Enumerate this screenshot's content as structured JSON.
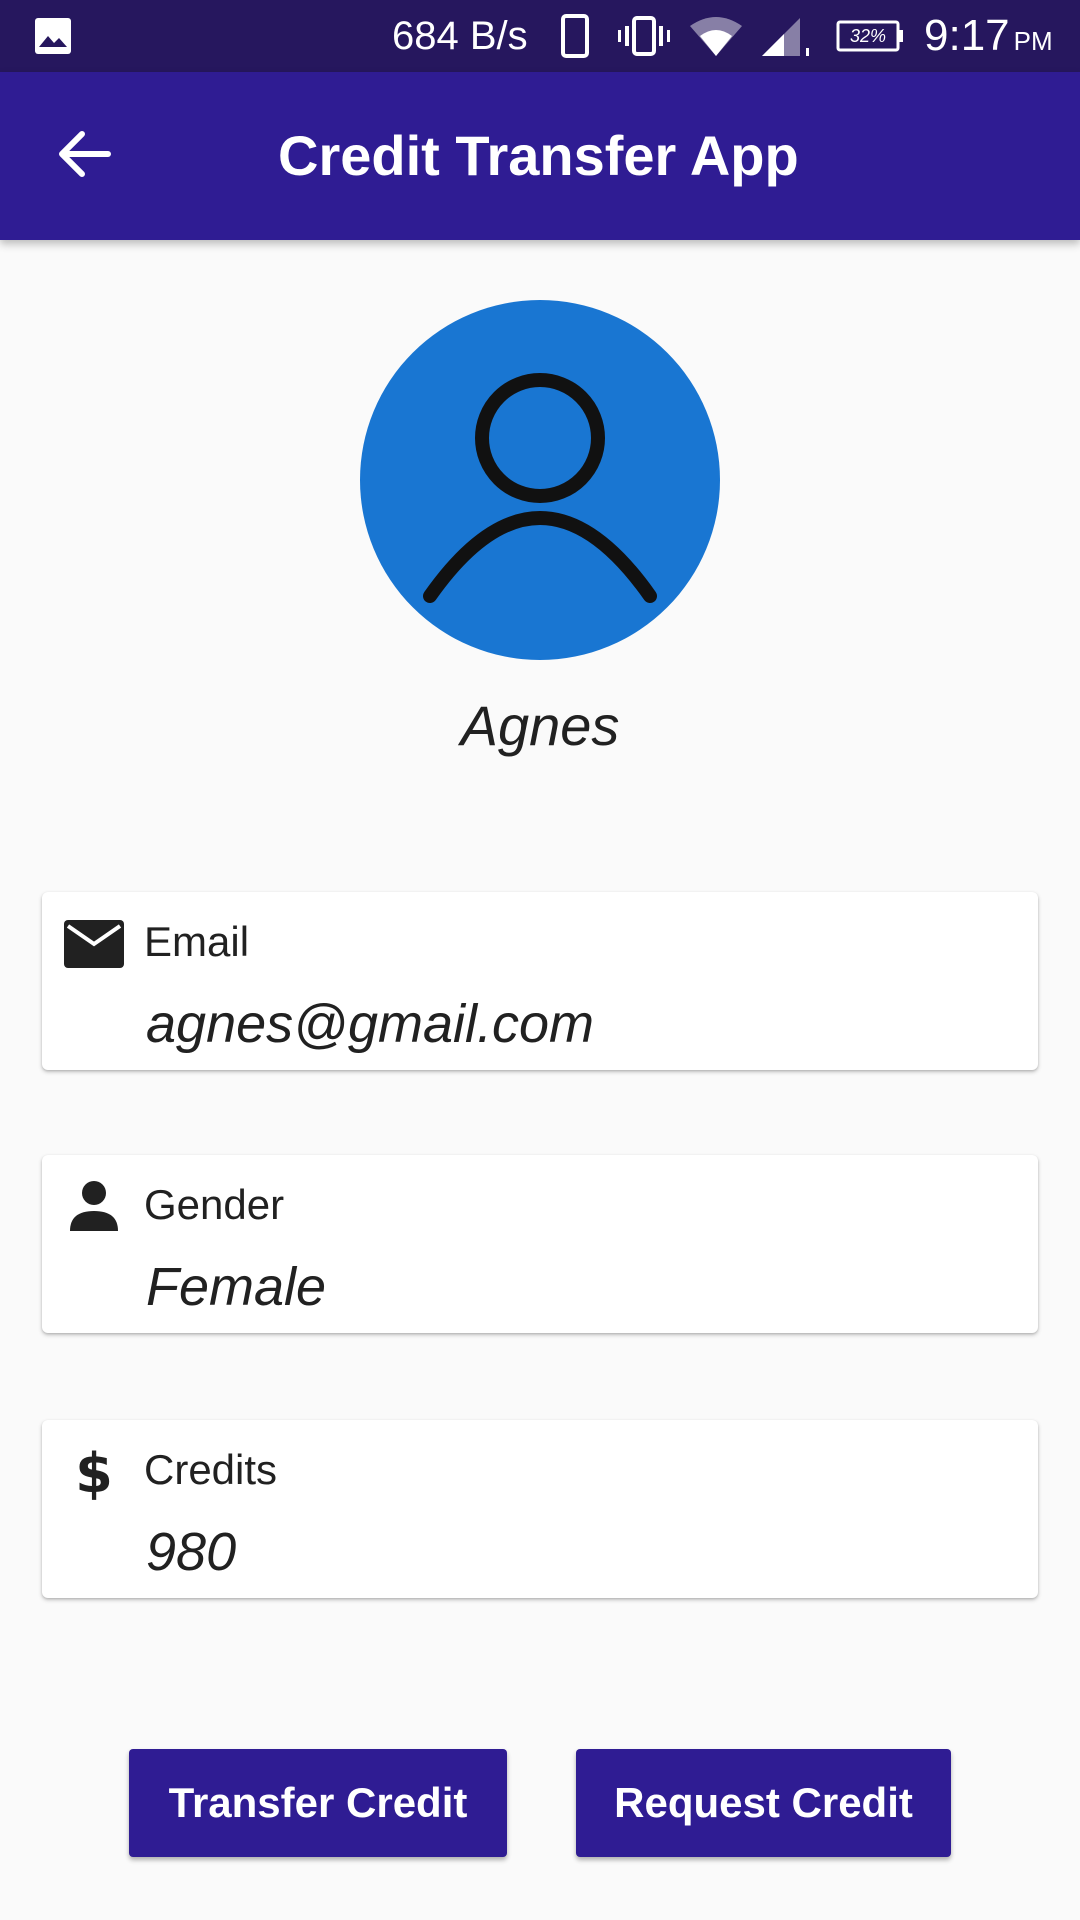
{
  "status_bar": {
    "network_speed": "684 B/s",
    "battery": "32%",
    "time": "9:17",
    "ampm": "PM",
    "icons": [
      "image-notification-icon",
      "phone-icon",
      "vibrate-icon",
      "wifi-icon",
      "cell-signal-icon",
      "battery-icon"
    ]
  },
  "app_bar": {
    "title": "Credit Transfer App",
    "background": "#2f1c93"
  },
  "profile": {
    "name": "Agnes",
    "avatar_color": "#1976d2"
  },
  "fields": {
    "email": {
      "label": "Email",
      "value": "agnes@gmail.com",
      "icon": "email-icon"
    },
    "gender": {
      "label": "Gender",
      "value": "Female",
      "icon": "person-icon"
    },
    "credits": {
      "label": "Credits",
      "value": "980",
      "icon": "dollar-icon"
    }
  },
  "actions": {
    "transfer_label": "Transfer Credit",
    "request_label": "Request Credit"
  }
}
